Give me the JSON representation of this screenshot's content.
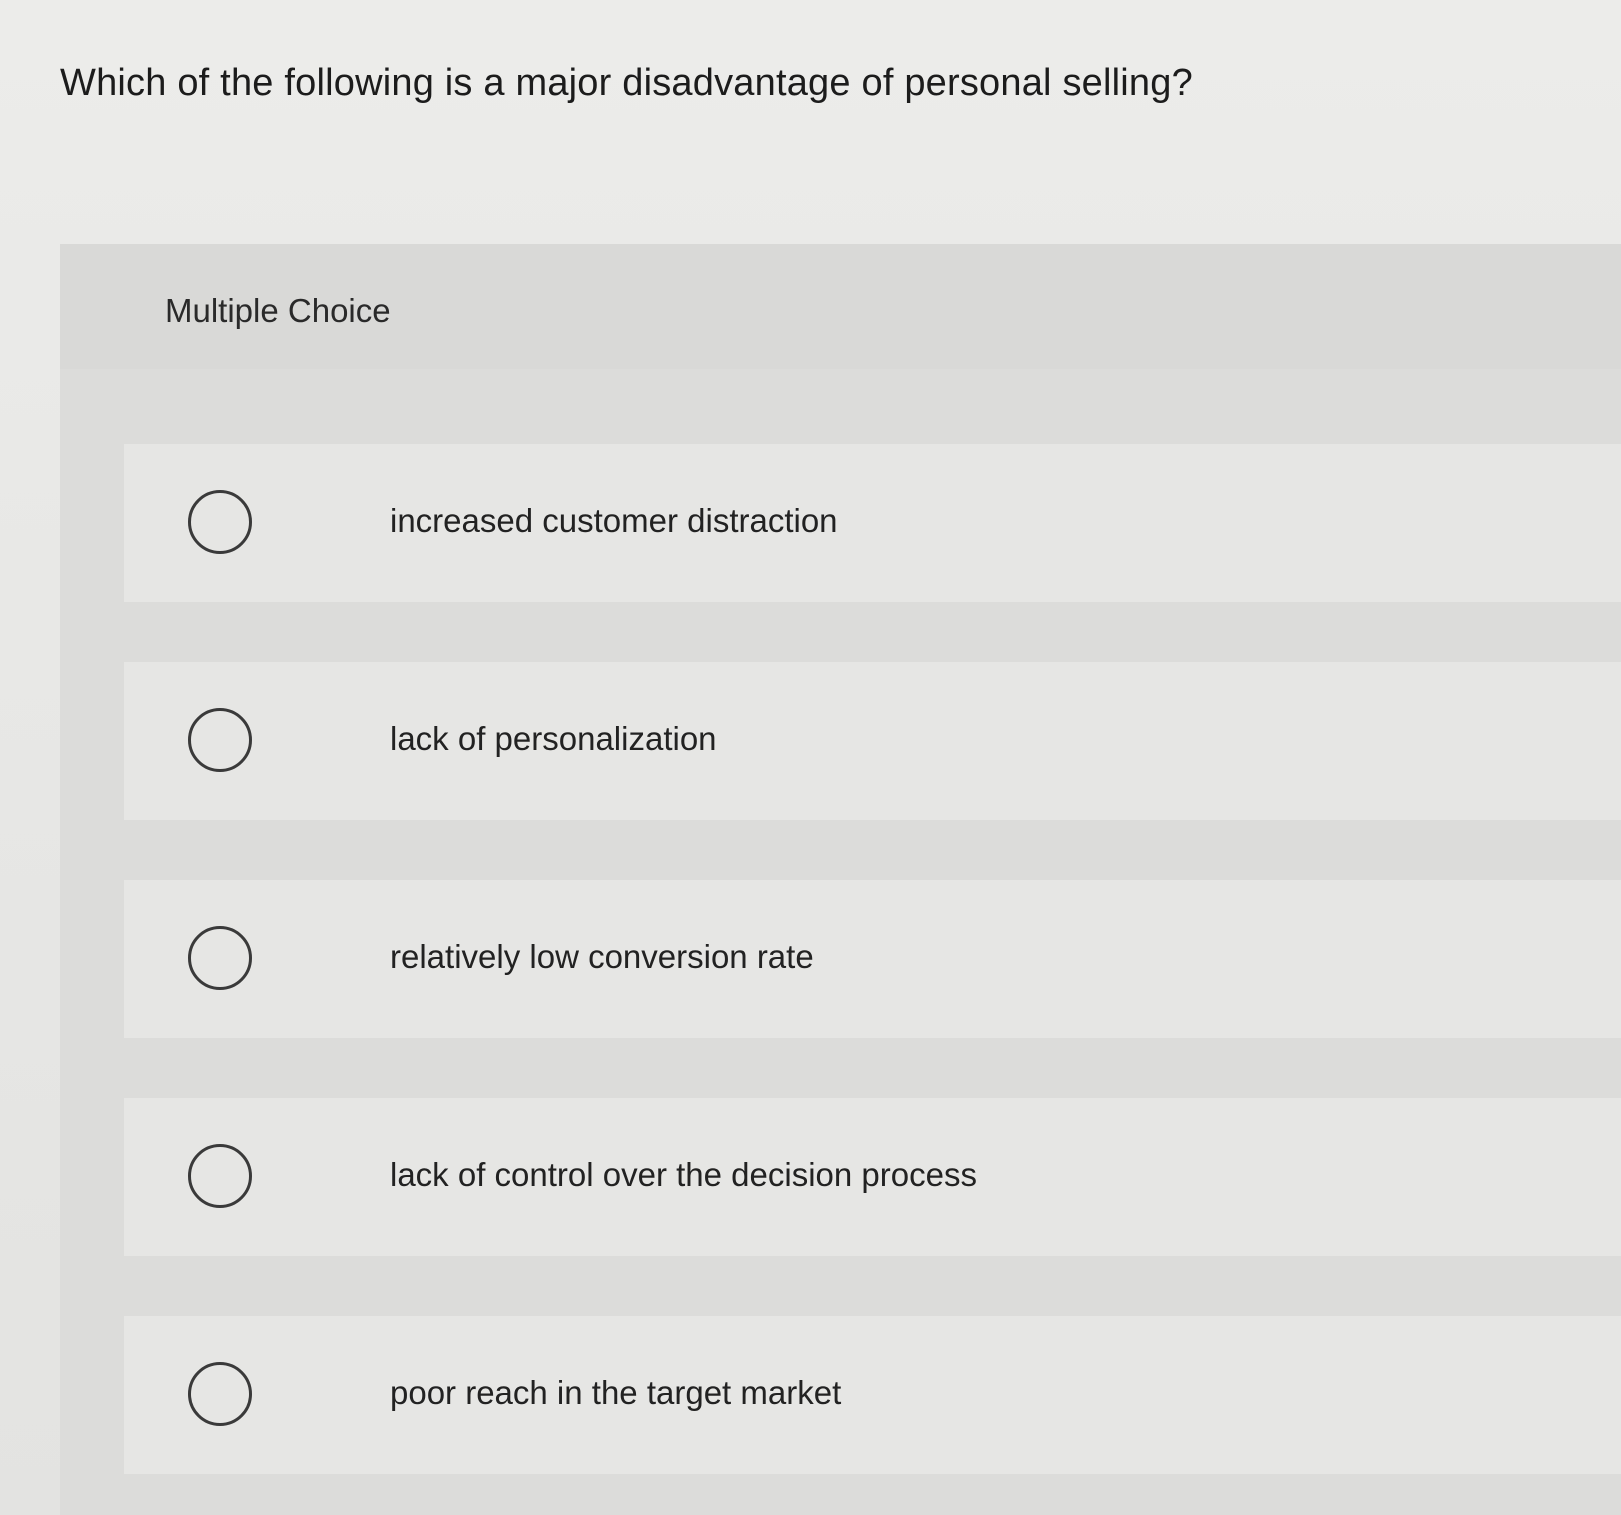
{
  "question": {
    "text": "Which of the following is a major disadvantage of personal selling?"
  },
  "panel": {
    "title": "Multiple Choice"
  },
  "options": [
    {
      "label": "increased customer distraction",
      "selected": false
    },
    {
      "label": "lack of personalization",
      "selected": false
    },
    {
      "label": "relatively low conversion rate",
      "selected": false
    },
    {
      "label": "lack of control over the decision process",
      "selected": false
    },
    {
      "label": "poor reach in the target market",
      "selected": false
    }
  ],
  "icons": {
    "radio": "radio-unchecked-icon"
  }
}
